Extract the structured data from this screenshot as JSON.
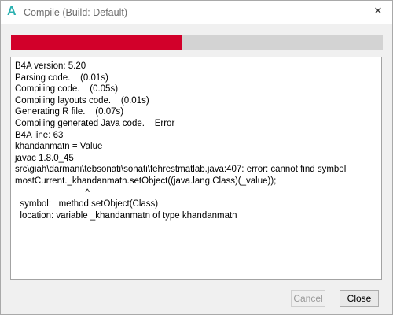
{
  "window": {
    "title": "Compile (Build: Default)",
    "app_icon_glyph": "A",
    "app_icon_color": "#2ab0b0",
    "close_glyph": "✕"
  },
  "progress": {
    "fraction": 0.46,
    "fill_color": "#d2002a",
    "track_color": "#d3d3d3"
  },
  "log": {
    "lines": [
      "B4A version: 5.20",
      "Parsing code.    (0.01s)",
      "Compiling code.    (0.05s)",
      "Compiling layouts code.    (0.01s)",
      "Generating R file.    (0.07s)",
      "Compiling generated Java code.    Error",
      "B4A line: 63",
      "khandanmatn = Value",
      "javac 1.8.0_45",
      "src\\giah\\darmani\\tebsonati\\sonati\\fehrestmatlab.java:407: error: cannot find symbol",
      "mostCurrent._khandanmatn.setObject((java.lang.Class)(_value));",
      "                            ^",
      "  symbol:   method setObject(Class)",
      "  location: variable _khandanmatn of type khandanmatn"
    ]
  },
  "buttons": {
    "cancel_label": "Cancel",
    "close_label": "Close"
  }
}
